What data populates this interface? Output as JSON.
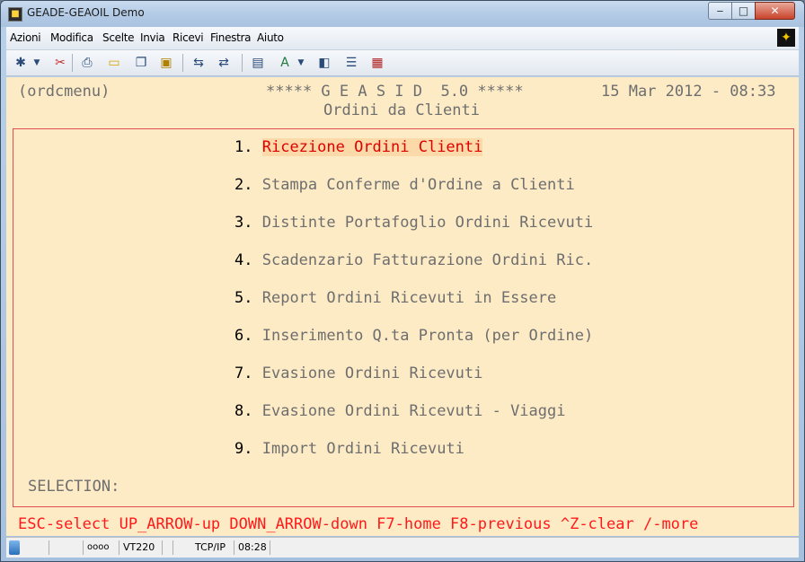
{
  "window": {
    "title": "GEADE-GEAOIL Demo",
    "controls": {
      "minimize": "‒",
      "maximize": "□",
      "close": "✕"
    }
  },
  "menubar": {
    "items": [
      {
        "label": "Azioni"
      },
      {
        "label": "Modifica"
      },
      {
        "label": "Scelte"
      },
      {
        "label": "Invia"
      },
      {
        "label": "Ricevi"
      },
      {
        "label": "Finestra"
      },
      {
        "label": "Aiuto"
      }
    ]
  },
  "toolbar": {
    "icons": [
      "new-session-icon",
      "dropdown-arrow-icon",
      "disconnect-icon",
      "print-icon",
      "open-folder-icon",
      "copy-icon",
      "paste-icon",
      "send-file-icon",
      "receive-file-icon",
      "book-icon",
      "font-icon",
      "dropdown-arrow-icon",
      "properties-icon",
      "settings-icon",
      "macro-icon"
    ]
  },
  "terminal": {
    "program": "(ordcmenu)",
    "banner": "***** G E A S I D  5.0 *****",
    "datetime": "15 Mar 2012 - 08:33",
    "subtitle": "Ordini da Clienti",
    "menu_options": [
      {
        "num": "1.",
        "label": "Ricezione Ordini Clienti",
        "selected": true
      },
      {
        "num": "2.",
        "label": "Stampa Conferme d'Ordine a Clienti"
      },
      {
        "num": "3.",
        "label": "Distinte Portafoglio Ordini Ricevuti"
      },
      {
        "num": "4.",
        "label": "Scadenzario Fatturazione Ordini Ric."
      },
      {
        "num": "5.",
        "label": "Report Ordini Ricevuti in Essere"
      },
      {
        "num": "6.",
        "label": "Inserimento Q.ta Pronta (per Ordine)"
      },
      {
        "num": "7.",
        "label": "Evasione Ordini Ricevuti"
      },
      {
        "num": "8.",
        "label": "Evasione Ordini Ricevuti - Viaggi"
      },
      {
        "num": "9.",
        "label": "Import Ordini Ricevuti"
      }
    ],
    "selection_prompt": "SELECTION:",
    "keys_help": "ESC-select UP_ARROW-up DOWN_ARROW-down F7-home F8-previous ^Z-clear /-more",
    "colors": {
      "background": "#fdebc6",
      "highlight": "#e00000",
      "frame": "#e05050"
    }
  },
  "statusbar": {
    "leds": "oooo",
    "emulation": "VT220",
    "protocol": "TCP/IP",
    "time": "08:28"
  }
}
